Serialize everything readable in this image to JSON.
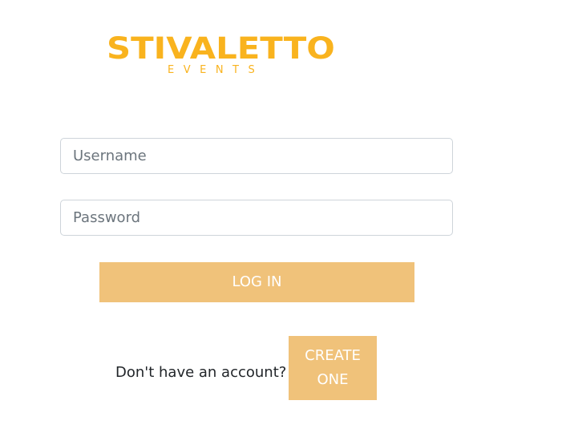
{
  "logo": {
    "title": "STIVALETTO",
    "subtitle": "EVENTS"
  },
  "form": {
    "username_placeholder": "Username",
    "password_placeholder": "Password",
    "login_label": "LOG IN"
  },
  "signup": {
    "prompt": "Don't have an account?",
    "button_line1": "CREATE",
    "button_line2": "ONE"
  },
  "colors": {
    "brand": "#f9b31e",
    "button": "#f0c27a",
    "border": "#ced4da"
  }
}
